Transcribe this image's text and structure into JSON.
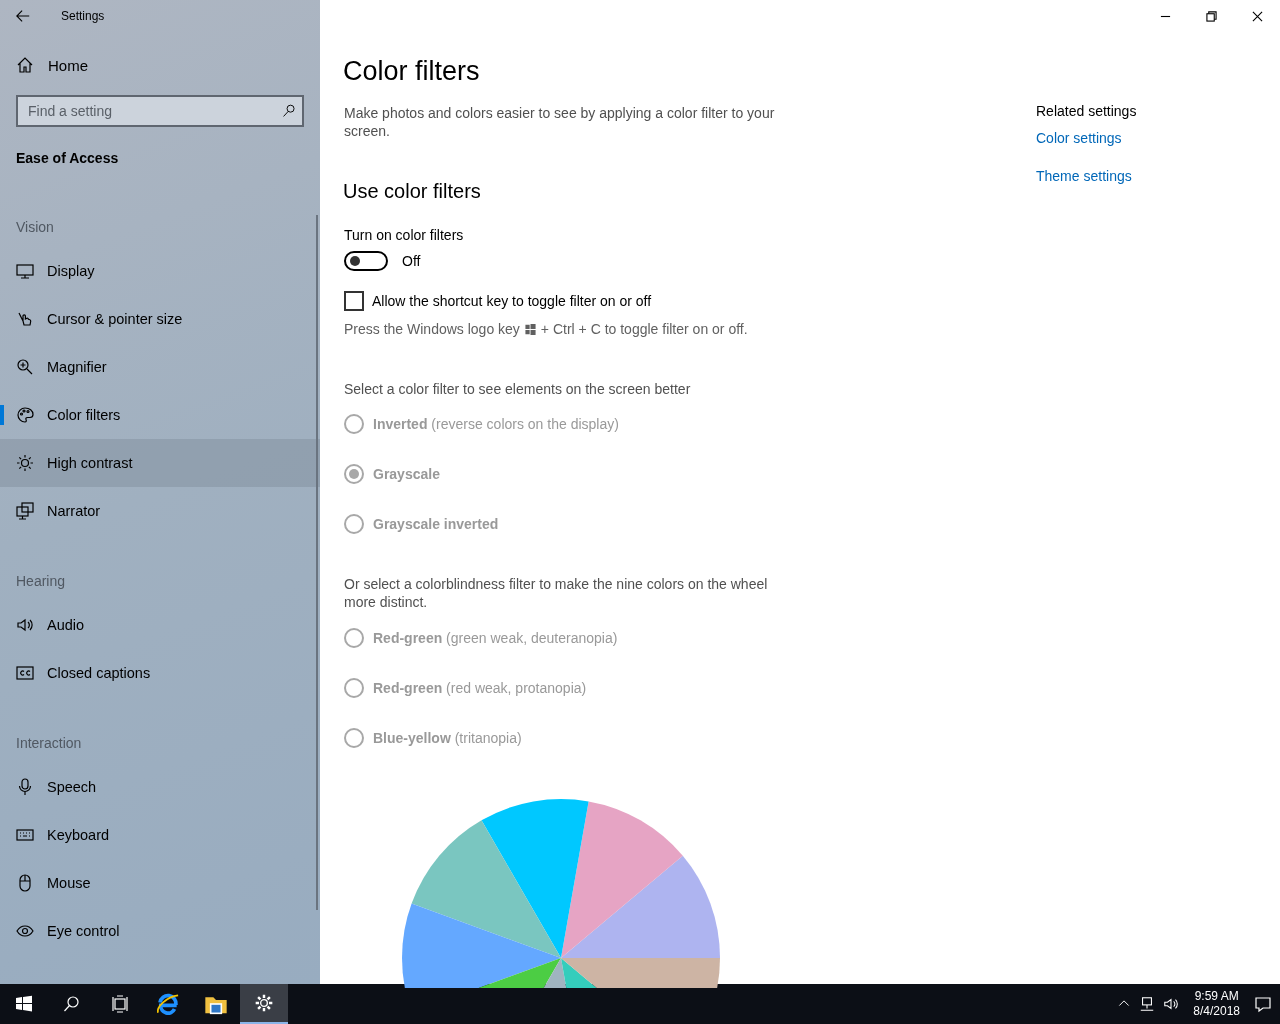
{
  "window": {
    "title": "Settings"
  },
  "sidebar": {
    "home": "Home",
    "search": {
      "placeholder": "Find a setting"
    },
    "category": "Ease of Access",
    "sections": [
      {
        "heading": "Vision",
        "items": [
          {
            "label": "Display",
            "selected": false,
            "hovered": false
          },
          {
            "label": "Cursor & pointer size",
            "selected": false,
            "hovered": false
          },
          {
            "label": "Magnifier",
            "selected": false,
            "hovered": false
          },
          {
            "label": "Color filters",
            "selected": true,
            "hovered": false
          },
          {
            "label": "High contrast",
            "selected": false,
            "hovered": true
          },
          {
            "label": "Narrator",
            "selected": false,
            "hovered": false
          }
        ]
      },
      {
        "heading": "Hearing",
        "items": [
          {
            "label": "Audio",
            "selected": false,
            "hovered": false
          },
          {
            "label": "Closed captions",
            "selected": false,
            "hovered": false
          }
        ]
      },
      {
        "heading": "Interaction",
        "items": [
          {
            "label": "Speech",
            "selected": false,
            "hovered": false
          },
          {
            "label": "Keyboard",
            "selected": false,
            "hovered": false
          },
          {
            "label": "Mouse",
            "selected": false,
            "hovered": false
          },
          {
            "label": "Eye control",
            "selected": false,
            "hovered": false
          }
        ]
      }
    ]
  },
  "page": {
    "title": "Color filters",
    "description": "Make photos and colors easier to see by applying a color filter to your screen.",
    "section_title": "Use color filters",
    "toggle": {
      "label": "Turn on color filters",
      "on": false,
      "state_text": "Off"
    },
    "checkbox": {
      "label": "Allow the shortcut key to toggle filter on or off",
      "checked": false
    },
    "shortcut_hint": {
      "before": "Press the Windows logo key",
      "after": "+ Ctrl + C to toggle filter on or off."
    },
    "filter_prompt": "Select a color filter to see elements on the screen better",
    "filters": [
      {
        "label": "**Inverted** (reverse colors on the display)",
        "selected": false,
        "disabled": true
      },
      {
        "label": "**Grayscale**",
        "selected": true,
        "disabled": true
      },
      {
        "label": "**Grayscale inverted**",
        "selected": false,
        "disabled": true
      }
    ],
    "colorblind_prompt": "Or select a colorblindness filter to make the nine colors on the wheel more distinct.",
    "colorblind_filters": [
      {
        "label": "**Red-green** (green weak, deuteranopia)",
        "selected": false,
        "disabled": true
      },
      {
        "label": "**Red-green** (red weak, protanopia)",
        "selected": false,
        "disabled": true
      },
      {
        "label": "**Blue-yellow** (tritanopia)",
        "selected": false,
        "disabled": true
      }
    ]
  },
  "related": {
    "heading": "Related settings",
    "links": [
      "Color settings",
      "Theme settings"
    ]
  },
  "taskbar": {
    "apps": [
      {
        "selected": false
      },
      {
        "selected": false
      },
      {
        "selected": false
      },
      {
        "selected": false
      },
      {
        "selected": false
      },
      {
        "selected": true
      }
    ],
    "time": "9:59 AM",
    "date": "8/4/2018"
  }
}
